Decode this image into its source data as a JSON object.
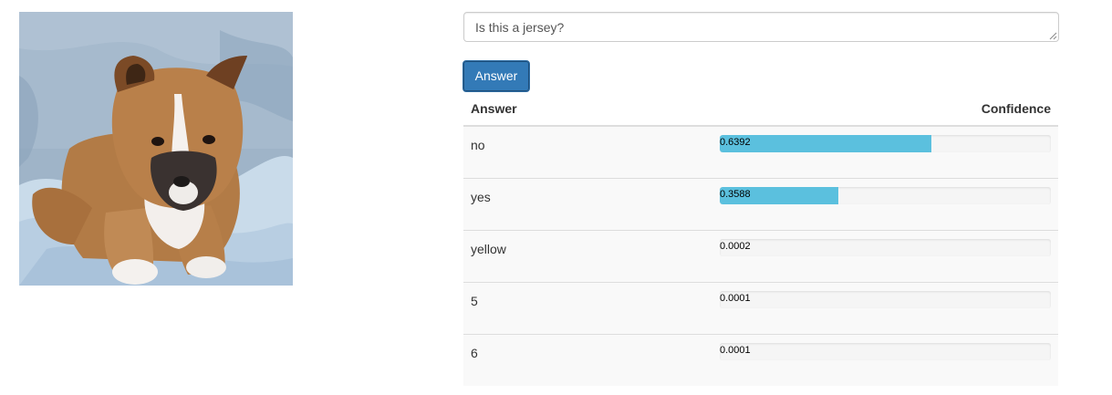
{
  "image": {
    "subject": "puppy-photo"
  },
  "question": {
    "value": "Is this a jersey?"
  },
  "answer_button": {
    "label": "Answer"
  },
  "results": {
    "headers": {
      "answer": "Answer",
      "confidence": "Confidence"
    },
    "rows": [
      {
        "answer": "no",
        "confidence": "0.6392",
        "fraction": 0.6392
      },
      {
        "answer": "yes",
        "confidence": "0.3588",
        "fraction": 0.3588
      },
      {
        "answer": "yellow",
        "confidence": "0.0002",
        "fraction": 0.0002
      },
      {
        "answer": "5",
        "confidence": "0.0001",
        "fraction": 0.0001
      },
      {
        "answer": "6",
        "confidence": "0.0001",
        "fraction": 0.0001
      }
    ]
  },
  "colors": {
    "primary_button": "#337ab7",
    "progress_fill": "#5bc0de",
    "progress_track": "#f5f5f5",
    "row_stripe": "#f9f9f9"
  }
}
